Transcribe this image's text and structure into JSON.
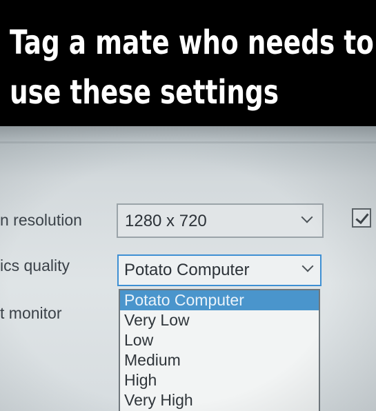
{
  "caption": {
    "line1": "Tag a mate who needs to",
    "line2": "use these settings"
  },
  "settings": {
    "resolution": {
      "label": "n resolution",
      "value": "1280 x 720",
      "checked": true
    },
    "quality": {
      "label": "ics quality",
      "value": "Potato Computer",
      "options": [
        "Potato Computer",
        "Very Low",
        "Low",
        "Medium",
        "High",
        "Very High"
      ],
      "highlighted_index": 0
    },
    "monitor": {
      "label": "t monitor"
    }
  },
  "colors": {
    "highlight": "#4a95cc",
    "focus_border": "#3d8fd3",
    "caption_bg": "#000000",
    "caption_text": "#ffffff"
  },
  "icons": {
    "dropdown": "chevron-down-icon",
    "checkbox": "checkmark-icon"
  }
}
